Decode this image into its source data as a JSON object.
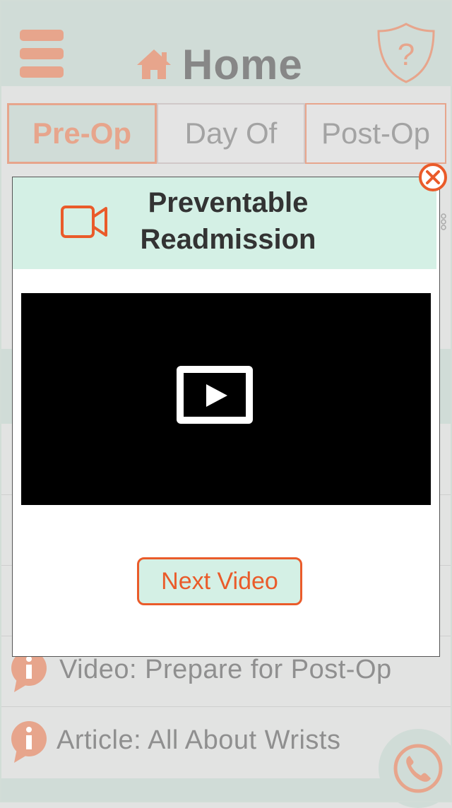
{
  "header": {
    "title": "Home"
  },
  "tabs": [
    {
      "label": "Pre-Op",
      "active": true
    },
    {
      "label": "Day Of",
      "active": false
    },
    {
      "label": "Post-Op",
      "active": false
    }
  ],
  "modal": {
    "title_line1": "Preventable",
    "title_line2": "Readmission",
    "next_button": "Next Video"
  },
  "list": {
    "items": [
      {
        "label": "Video: Prepare for Post-Op",
        "icon": "info-icon"
      },
      {
        "label": "Article: All About Wrists",
        "icon": "info-icon"
      }
    ]
  },
  "colors": {
    "accent": "#e7a58c",
    "header_bg": "#d0dcd7",
    "modal_header_bg": "#d4f0e5",
    "button_orange": "#ea5b2a"
  }
}
